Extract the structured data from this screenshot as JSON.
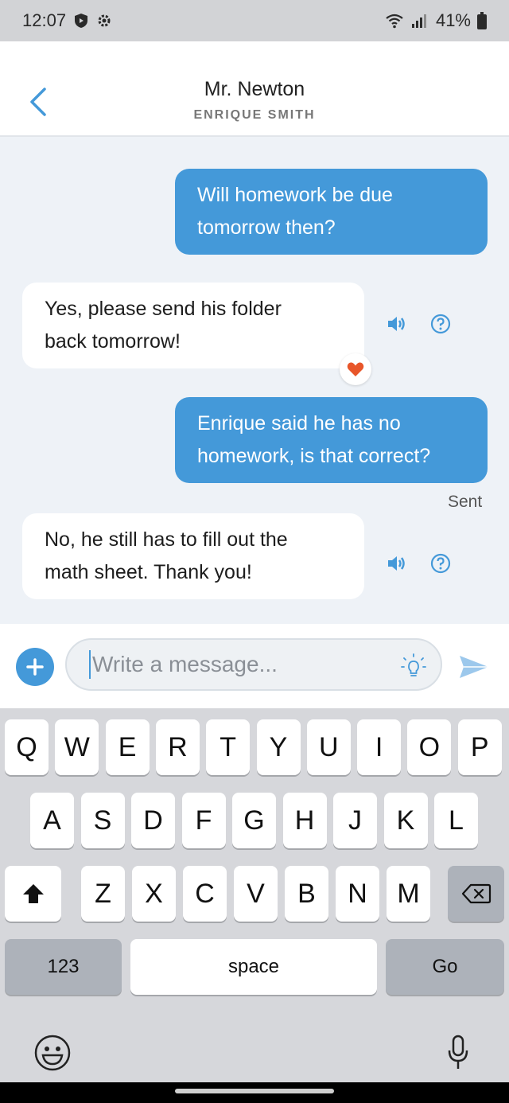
{
  "status_bar": {
    "time": "12:07",
    "battery": "41%"
  },
  "header": {
    "title": "Mr. Newton",
    "subtitle": "ENRIQUE SMITH"
  },
  "messages": [
    {
      "direction": "sent",
      "lines": [
        "Will homework be due",
        "tomorrow then?"
      ]
    },
    {
      "direction": "received",
      "lines": [
        "Yes, please send his folder",
        "back tomorrow!"
      ],
      "reaction": "heart-icon"
    },
    {
      "direction": "sent",
      "lines": [
        "Enrique said he has no",
        "homework, is that correct?"
      ],
      "status": "Sent"
    },
    {
      "direction": "received",
      "lines": [
        "No, he still has to fill out the",
        "math sheet. Thank you!"
      ]
    }
  ],
  "composer": {
    "placeholder": "Write a message..."
  },
  "keyboard": {
    "row1": [
      "Q",
      "W",
      "E",
      "R",
      "T",
      "Y",
      "U",
      "I",
      "O",
      "P"
    ],
    "row2": [
      "A",
      "S",
      "D",
      "F",
      "G",
      "H",
      "J",
      "K",
      "L"
    ],
    "row3": [
      "Z",
      "X",
      "C",
      "V",
      "B",
      "N",
      "M"
    ],
    "numbers_label": "123",
    "space_label": "space",
    "go_label": "Go"
  },
  "colors": {
    "accent": "#4499d9",
    "reaction": "#e8562a",
    "background": "#eef2f7"
  }
}
